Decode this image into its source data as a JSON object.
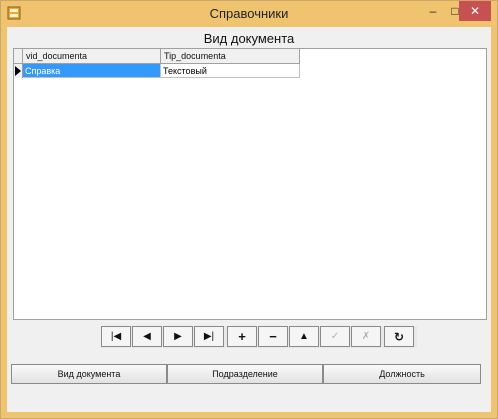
{
  "window": {
    "title": "Справочники",
    "controls": {
      "minimize": "–",
      "maximize": "□",
      "close": "✕"
    }
  },
  "grid": {
    "caption": "Вид документа",
    "columns": [
      "vid_documenta",
      "Tip_documenta"
    ],
    "rows": [
      [
        "Справка",
        "Текстовый"
      ]
    ]
  },
  "navigator": {
    "buttons": [
      {
        "name": "first",
        "glyph": "|◀",
        "enabled": true
      },
      {
        "name": "prior",
        "glyph": "◀",
        "enabled": true
      },
      {
        "name": "next",
        "glyph": "▶",
        "enabled": true
      },
      {
        "name": "last",
        "glyph": "▶|",
        "enabled": true
      },
      {
        "name": "insert",
        "glyph": "+",
        "enabled": true
      },
      {
        "name": "delete",
        "glyph": "−",
        "enabled": true
      },
      {
        "name": "edit",
        "glyph": "▲",
        "enabled": true
      },
      {
        "name": "post",
        "glyph": "✓",
        "enabled": false
      },
      {
        "name": "cancel",
        "glyph": "✗",
        "enabled": false
      },
      {
        "name": "refresh",
        "glyph": "↻",
        "enabled": true
      }
    ]
  },
  "tabs": [
    "Вид документа",
    "Подразделение",
    "Должность"
  ],
  "colors": {
    "title_bar": "#f0c46e",
    "selection": "#3399ff",
    "close_button": "#c75050"
  }
}
